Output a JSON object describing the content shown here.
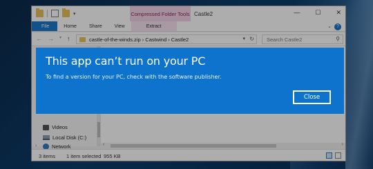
{
  "colors": {
    "dialog_bg": "#0d73cc",
    "file_tab": "#1979ca",
    "contextual_tab": "#f3d3e6"
  },
  "titlebar": {
    "contextual_tab": "Compressed Folder Tools",
    "title": "Castle2",
    "controls": [
      "—",
      "☐",
      "✕"
    ]
  },
  "ribbon": {
    "tabs": [
      "File",
      "Home",
      "Share",
      "View",
      "Extract"
    ],
    "help": "?"
  },
  "address": {
    "path": "castle-of-the-winds.zip  ›  Castwind  ›  Castle2",
    "search_placeholder": "Search Castle2"
  },
  "nav": {
    "items": [
      {
        "label": "Videos",
        "icon": "video-folder-icon"
      },
      {
        "label": "Local Disk (C:)",
        "icon": "drive-icon"
      },
      {
        "label": "Network",
        "icon": "network-icon"
      }
    ]
  },
  "status": {
    "item_count": "3 items",
    "selected": "1 item selected",
    "size": "955 KB"
  },
  "dialog": {
    "title": "This app can’t run on your PC",
    "message": "To find a version for your PC, check with the software publisher.",
    "close_label": "Close"
  }
}
